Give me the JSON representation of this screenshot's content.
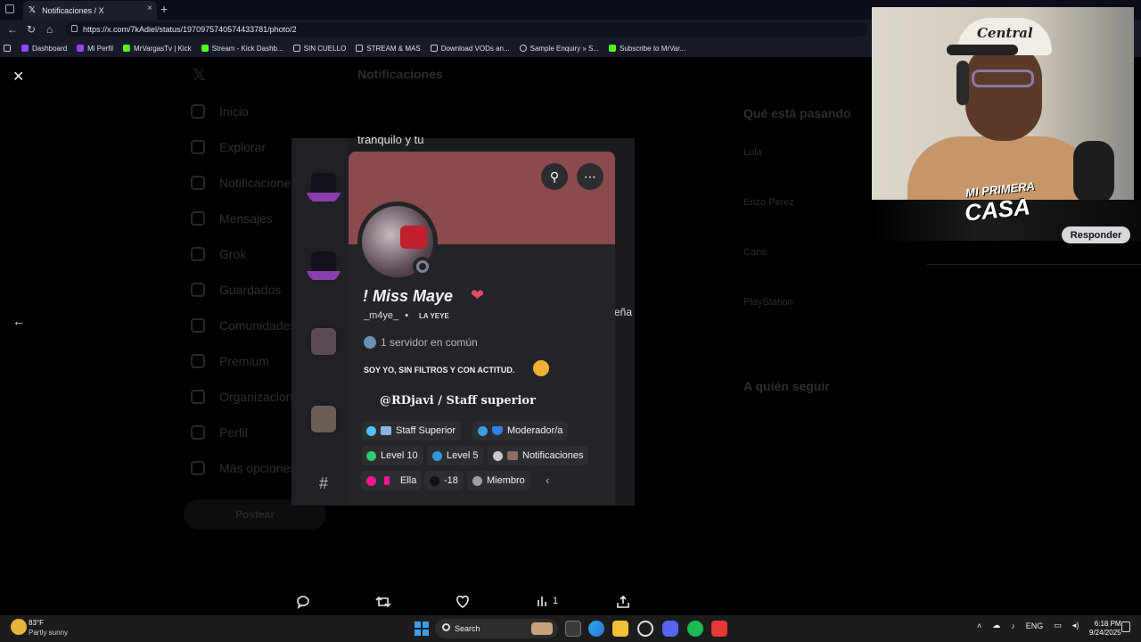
{
  "browser": {
    "tab_title": "Notificaciones / X",
    "tab_close": "×",
    "new_tab": "+",
    "url": "https://x.com/7kAdiel/status/1970975740574433781/photo/2",
    "bookmarks": [
      {
        "label": "Dashboard",
        "color": "#9146ff"
      },
      {
        "label": "Mi Perfil",
        "color": "#9146ff"
      },
      {
        "label": "MrVargasTv | Kick",
        "color": "#53fc18"
      },
      {
        "label": "Stream - Kick Dashb...",
        "color": "#53fc18"
      },
      {
        "label": "SIN CUELLO",
        "color": "#c8c8c8"
      },
      {
        "label": "STREAM & MAS",
        "color": "#c8c8c8"
      },
      {
        "label": "Download VODs an...",
        "color": "#c8c8c8"
      },
      {
        "label": "Sample Enquiry » S...",
        "color": "#c8c8c8"
      },
      {
        "label": "Subscribe to MrVar...",
        "color": "#53fc18"
      }
    ]
  },
  "x_page": {
    "sidebar": [
      "Inicio",
      "Explorar",
      "Notificaciones",
      "Mensajes",
      "Grok",
      "Guardados",
      "Comunidades",
      "Premium",
      "Organizaciones",
      "Perfil",
      "Más opciones"
    ],
    "header_title": "Notificaciones",
    "post_button": "Postear",
    "trends_title": "Qué está pasando",
    "trends": [
      "Lula",
      "Enzo Perez",
      "Cano",
      "PlayStation"
    ],
    "follow_title": "A quién seguir",
    "actions": {
      "reply_icon": "comment-icon",
      "repost_icon": "repost-icon",
      "like_icon": "heart-icon",
      "views_count": "1",
      "share_icon": "share-icon"
    }
  },
  "discord_profile": {
    "display_name": "! Miss Maye",
    "username": "_m4ye_",
    "separator": "•",
    "pronoun_tag": "LA YEYE",
    "mutual_servers": "1 servidor en común",
    "bio": "SOY YO, SIN FILTROS Y CON ACTITUD.",
    "staff_line": "@RDjavi / Staff superior",
    "roles_row1": [
      {
        "label": "Staff Superior",
        "dot": "#4fc3f7",
        "emoji": "#8fb3e0"
      },
      {
        "label": "Moderador/a",
        "dot": "#3b9ee8",
        "emoji": "#2f7fe8"
      }
    ],
    "roles_row2": [
      {
        "label": "Level 10",
        "dot": "#2ecc71"
      },
      {
        "label": "Level 5",
        "dot": "#3498db"
      },
      {
        "label": "Notificaciones",
        "dot": "#c8c8c8",
        "emoji": "#8d6e63"
      }
    ],
    "roles_row3": [
      {
        "label": "Ella",
        "dot": "#ff1493",
        "emoji": "#ff1493"
      },
      {
        "label": "-18",
        "dot": "#111111"
      },
      {
        "label": "Miembro",
        "dot": "#9e9e9e"
      }
    ],
    "collapse": "‹",
    "partial_top": "tranquilo y tu",
    "partial_right": "eña",
    "chat_hash": "#"
  },
  "overlay": {
    "cam_hat_text": "Central",
    "title_line1": "MI PRIMERA",
    "title_line2": "CASA",
    "responder_button": "Responder"
  },
  "taskbar": {
    "temperature": "83°F",
    "weather": "Partly sunny",
    "search_placeholder": "Search",
    "language": "ENG",
    "time": "6:18 PM",
    "date": "9/24/2025"
  },
  "colors": {
    "banner": "#8b4a4d",
    "card_bg": "#232428",
    "page_bg": "#000000",
    "taskbar_bg": "#1c1c1c"
  }
}
